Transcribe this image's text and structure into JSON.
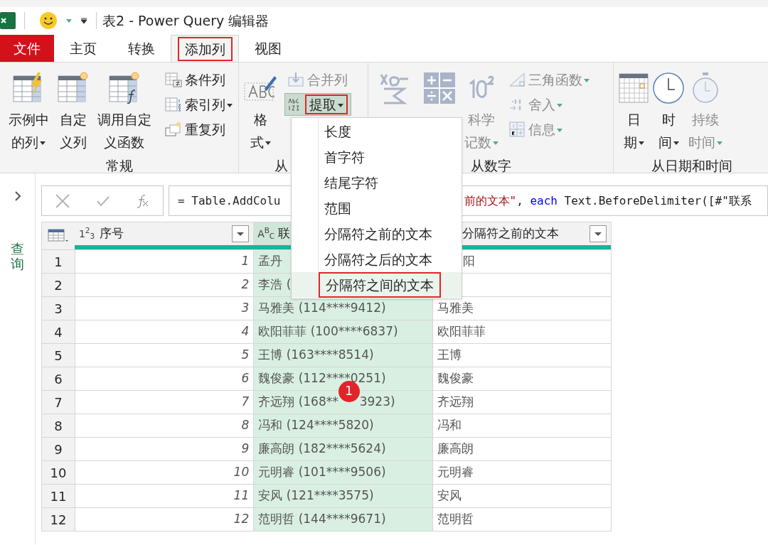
{
  "window": {
    "title": "表2 - Power Query 编辑器"
  },
  "tabs": [
    {
      "label": "文件",
      "kind": "file",
      "selected": false
    },
    {
      "label": "主页",
      "kind": "tab",
      "selected": false
    },
    {
      "label": "转换",
      "kind": "tab",
      "selected": false
    },
    {
      "label": "添加列",
      "kind": "tab",
      "selected": true
    },
    {
      "label": "视图",
      "kind": "tab",
      "selected": false
    }
  ],
  "ribbon": {
    "groups": [
      {
        "label": "常规",
        "large": [
          {
            "label": "示例中的列",
            "kind": "flash",
            "dropdown": true,
            "disabled": false
          },
          {
            "label": "自定义列",
            "kind": "custom",
            "dropdown": false,
            "disabled": false
          },
          {
            "label": "调用自定义函数",
            "kind": "invoke",
            "dropdown": false,
            "disabled": false
          }
        ],
        "small": [
          {
            "label": "条件列",
            "kind": "conditional",
            "dropdown": false,
            "disabled": false,
            "highlighted": false
          },
          {
            "label": "索引列",
            "kind": "index",
            "dropdown": true,
            "disabled": false,
            "highlighted": false
          },
          {
            "label": "重复列",
            "kind": "duplicate",
            "dropdown": false,
            "disabled": false,
            "highlighted": false
          }
        ]
      },
      {
        "label": "从",
        "large": [
          {
            "label": "格式",
            "kind": "format",
            "dropdown": true,
            "disabled": false
          }
        ],
        "small": [
          {
            "label": "合并列",
            "kind": "merge",
            "dropdown": false,
            "disabled": true,
            "highlighted": false
          },
          {
            "label": "提取",
            "kind": "extract",
            "dropdown": true,
            "disabled": false,
            "highlighted": true
          }
        ]
      },
      {
        "label": "从数字",
        "large": [
          {
            "kind": "statistics",
            "disabled": true
          },
          {
            "kind": "standard",
            "disabled": true
          },
          {
            "label": "科学记数",
            "kind": "scientific",
            "dropdown": true,
            "disabled": true
          }
        ],
        "small": [
          {
            "label": "三角函数",
            "kind": "trig",
            "dropdown": true,
            "disabled": true,
            "highlighted": false
          },
          {
            "label": "舍入",
            "kind": "rounding",
            "dropdown": true,
            "disabled": true,
            "highlighted": false
          },
          {
            "label": "信息",
            "kind": "information",
            "dropdown": true,
            "disabled": true,
            "highlighted": false
          }
        ]
      },
      {
        "label": "从日期和时间",
        "large": [
          {
            "label": "日期",
            "kind": "date",
            "dropdown": true,
            "disabled": false
          },
          {
            "label": "时间",
            "kind": "time",
            "dropdown": true,
            "disabled": false
          },
          {
            "label": "持续时间",
            "kind": "duration",
            "dropdown": true,
            "disabled": true
          }
        ]
      }
    ]
  },
  "menu": {
    "items": [
      {
        "label": "长度",
        "selected": false
      },
      {
        "label": "首字符",
        "selected": false
      },
      {
        "label": "结尾字符",
        "selected": false
      },
      {
        "label": "范围",
        "selected": false
      },
      {
        "label": "分隔符之前的文本",
        "selected": false
      },
      {
        "label": "分隔符之后的文本",
        "selected": false
      },
      {
        "label": "分隔符之间的文本",
        "selected": true
      }
    ]
  },
  "sidebar": {
    "title": "查询"
  },
  "formula": {
    "start": "= Table.AddColu",
    "end": [
      {
        "kind": "string",
        "text": "前的文本\""
      },
      {
        "kind": "plain",
        "text": ", "
      },
      {
        "kind": "keyword",
        "text": "each"
      },
      {
        "kind": "plain",
        "text": " Text.BeforeDelimiter([#\"联系"
      }
    ]
  },
  "table": {
    "columns": [
      {
        "type": "1$^{2}$$_{3}$",
        "name": "序号",
        "kind": "number",
        "selected": false,
        "under_menu": false
      },
      {
        "type": "A$^{B}$$_{C}$",
        "name": "联",
        "kind": "text",
        "selected": true,
        "under_menu": true
      },
      {
        "name": "分隔符之前的文本",
        "kind": "text",
        "selected": false,
        "under_menu": false
      }
    ],
    "rows": [
      {
        "index": "1",
        "under_menu": true,
        "cells": [
          "1",
          "孟丹",
          "阳"
        ]
      },
      {
        "index": "2",
        "under_menu": true,
        "cells": [
          "2",
          "李浩 (",
          null
        ]
      },
      {
        "index": "3",
        "under_menu": false,
        "cells": [
          "3",
          "马雅美 (114****9412)",
          "马雅美"
        ]
      },
      {
        "index": "4",
        "under_menu": false,
        "cells": [
          "4",
          "欧阳菲菲 (100****6837)",
          "欧阳菲菲"
        ]
      },
      {
        "index": "5",
        "under_menu": false,
        "cells": [
          "5",
          "王博 (163****8514)",
          "王博"
        ]
      },
      {
        "index": "6",
        "under_menu": false,
        "cells": [
          "6",
          "魏俊豪 (112****0251)",
          "魏俊豪"
        ]
      },
      {
        "index": "7",
        "under_menu": false,
        "callout": "1",
        "cells": [
          "7",
          [
            "齐远翔 (168**",
            "3923)"
          ],
          "齐远翔"
        ]
      },
      {
        "index": "8",
        "under_menu": false,
        "cells": [
          "8",
          "冯和 (124****5820)",
          "冯和"
        ]
      },
      {
        "index": "9",
        "under_menu": false,
        "cells": [
          "9",
          "廉高朗 (182****5624)",
          "廉高朗"
        ]
      },
      {
        "index": "10",
        "under_menu": false,
        "cells": [
          "10",
          "元明睿 (101****9506)",
          "元明睿"
        ]
      },
      {
        "index": "11",
        "under_menu": false,
        "cells": [
          "11",
          "安风 (121****3575)",
          "安风"
        ]
      },
      {
        "index": "12",
        "under_menu": false,
        "cells": [
          "12",
          "范明哲 (144****9671)",
          "范明哲"
        ]
      }
    ]
  }
}
